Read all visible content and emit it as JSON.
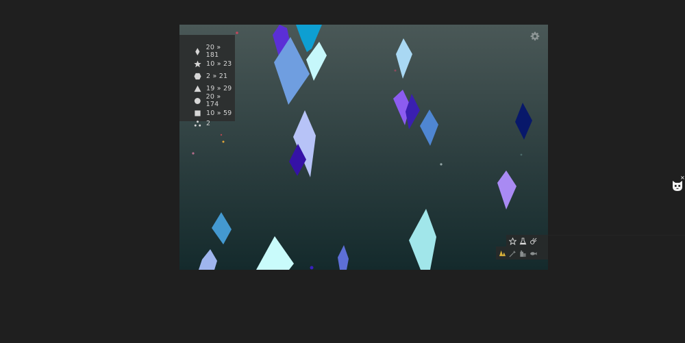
{
  "stats": [
    {
      "icon": "diamond-icon",
      "text": "20 » 181"
    },
    {
      "icon": "star-icon",
      "text": "10 » 23"
    },
    {
      "icon": "hexagon-icon",
      "text": "2 » 21"
    },
    {
      "icon": "triangle-icon",
      "text": "19 » 29"
    },
    {
      "icon": "circle-icon",
      "text": "20 » 174"
    },
    {
      "icon": "square-icon",
      "text": "10 » 59"
    },
    {
      "icon": "dots-icon",
      "text": "2"
    }
  ],
  "toolbar": {
    "top": [
      "star-outline-icon",
      "flask-icon",
      "comet-icon"
    ],
    "bottom": [
      "tree-icon",
      "sparkle-wand-icon",
      "building-icon",
      "fish-icon"
    ]
  },
  "colors": {
    "page_bg": "#1f1f1f",
    "stage_top": "#4a5857",
    "stage_bottom": "#142a2c",
    "panel": "#2d3030",
    "text": "#d6d6d6"
  },
  "crystals": [
    {
      "color": "#5b2fd6"
    },
    {
      "color": "#0e9fd2"
    },
    {
      "color": "#6f9ee0"
    },
    {
      "color": "#c6f7fb"
    },
    {
      "color": "#a9d8f3"
    },
    {
      "color": "#8c5cf0"
    },
    {
      "color": "#3a1fb0"
    },
    {
      "color": "#4f86d2"
    },
    {
      "color": "#b7c3f7"
    },
    {
      "color": "#3512a6"
    },
    {
      "color": "#08186a"
    },
    {
      "color": "#a98af3"
    },
    {
      "color": "#4499d0"
    },
    {
      "color": "#9fb5ee"
    },
    {
      "color": "#c9fbfb"
    },
    {
      "color": "#5d6fd7"
    },
    {
      "color": "#a1e6ea"
    }
  ]
}
